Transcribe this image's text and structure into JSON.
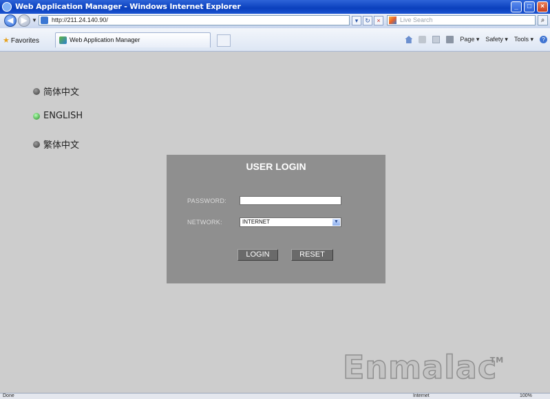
{
  "window": {
    "title": "Web Application Manager - Windows Internet Explorer",
    "minimize": "_",
    "maximize": "□",
    "close": "×"
  },
  "address": {
    "back": "◀",
    "forward": "▶",
    "url": "http://211.24.140.90/",
    "search_placeholder": "Live Search"
  },
  "toolbar": {
    "favorites_label": "Favorites",
    "tab_label": "Web Application Manager",
    "page_menu": "Page ▾",
    "safety_menu": "Safety ▾",
    "tools_menu": "Tools ▾"
  },
  "languages": [
    {
      "label": "简体中文",
      "active": false
    },
    {
      "label": "ENGLISH",
      "active": true
    },
    {
      "label": "繁体中文",
      "active": false
    }
  ],
  "login": {
    "title": "USER LOGIN",
    "password_label": "PASSWORD:",
    "network_label": "NETWORK:",
    "network_value": "INTERNET",
    "login_button": "LOGIN",
    "reset_button": "RESET"
  },
  "brand": {
    "name": "Enmalac",
    "tm": "TM"
  },
  "status": {
    "left": "Done",
    "zone": "Internet",
    "zoom": "100%"
  },
  "colors": {
    "titlebar": "#0a3fbd",
    "content_bg": "#cdcdcd",
    "login_panel": "#8f8f8f",
    "active_dot": "#1f8a1f"
  }
}
